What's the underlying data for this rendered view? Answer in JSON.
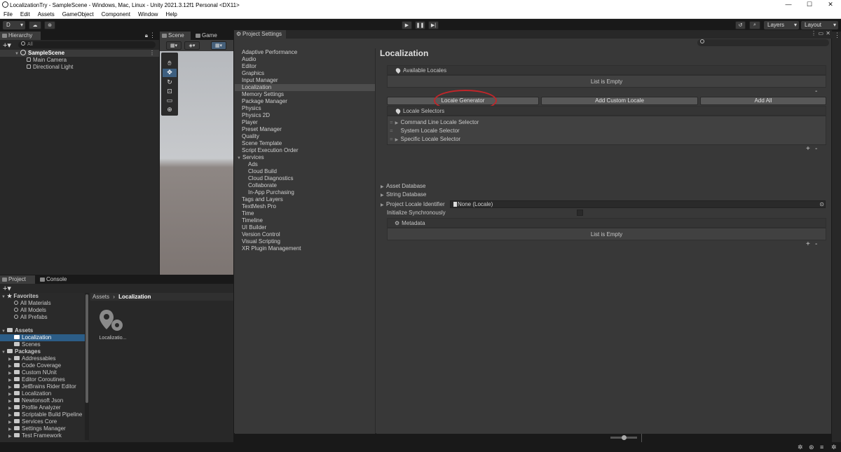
{
  "window": {
    "title": "LocalizationTry - SampleScene - Windows, Mac, Linux - Unity 2021.3.12f1 Personal <DX11>",
    "min": "—",
    "max": "☐",
    "close": "✕"
  },
  "menu": [
    "File",
    "Edit",
    "Assets",
    "GameObject",
    "Component",
    "Window",
    "Help"
  ],
  "toolbar": {
    "account": "D",
    "layers": "Layers",
    "layout": "Layout"
  },
  "hierarchy": {
    "tab": "Hierarchy",
    "search_placeholder": "All",
    "scene": "SampleScene",
    "items": [
      "Main Camera",
      "Directional Light"
    ]
  },
  "scene_tabs": {
    "scene": "Scene",
    "game": "Game"
  },
  "project_settings": {
    "title": "Project Settings",
    "search_placeholder": "",
    "categories": [
      "Adaptive Performance",
      "Audio",
      "Editor",
      "Graphics",
      "Input Manager",
      "Localization",
      "Memory Settings",
      "Package Manager",
      "Physics",
      "Physics 2D",
      "Player",
      "Preset Manager",
      "Quality",
      "Scene Template",
      "Script Execution Order",
      "Services"
    ],
    "services": [
      "Ads",
      "Cloud Build",
      "Cloud Diagnostics",
      "Collaborate",
      "In-App Purchasing"
    ],
    "categories2": [
      "Tags and Layers",
      "TextMesh Pro",
      "Time",
      "Timeline",
      "UI Builder",
      "Version Control",
      "Visual Scripting",
      "XR Plugin Management"
    ],
    "selected": "Localization",
    "heading": "Localization",
    "available_locales": "Available Locales",
    "list_empty": "List is Empty",
    "buttons": {
      "locale_generator": "Locale Generator",
      "add_custom_locale": "Add Custom Locale",
      "add_all": "Add All"
    },
    "locale_selectors": "Locale Selectors",
    "selectors": [
      "Command Line Locale Selector",
      "System Locale Selector",
      "Specific Locale Selector"
    ],
    "asset_database": "Asset Database",
    "string_database": "String Database",
    "project_locale_identifier": "Project Locale Identifier",
    "project_locale_value": "None (Locale)",
    "initialize_sync": "Initialize Synchronously",
    "metadata": "Metadata",
    "metadata_empty": "List is Empty",
    "plus": "+",
    "minus": "-"
  },
  "project": {
    "tab_project": "Project",
    "tab_console": "Console",
    "favorites": "Favorites",
    "fav_items": [
      "All Materials",
      "All Models",
      "All Prefabs"
    ],
    "assets": "Assets",
    "asset_items": [
      "Localization",
      "Scenes"
    ],
    "packages": "Packages",
    "package_items": [
      "Addressables",
      "Code Coverage",
      "Custom NUnit",
      "Editor Coroutines",
      "JetBrains Rider Editor",
      "Localization",
      "Newtonsoft Json",
      "Profile Analyzer",
      "Scriptable Build Pipeline",
      "Services Core",
      "Settings Manager",
      "Test Framework"
    ],
    "breadcrumb_root": "Assets",
    "breadcrumb_current": "Localization",
    "asset_file": "Localizatio..."
  },
  "colors": {
    "highlight_circle": "#c0262a",
    "selection": "#2c5d87"
  }
}
